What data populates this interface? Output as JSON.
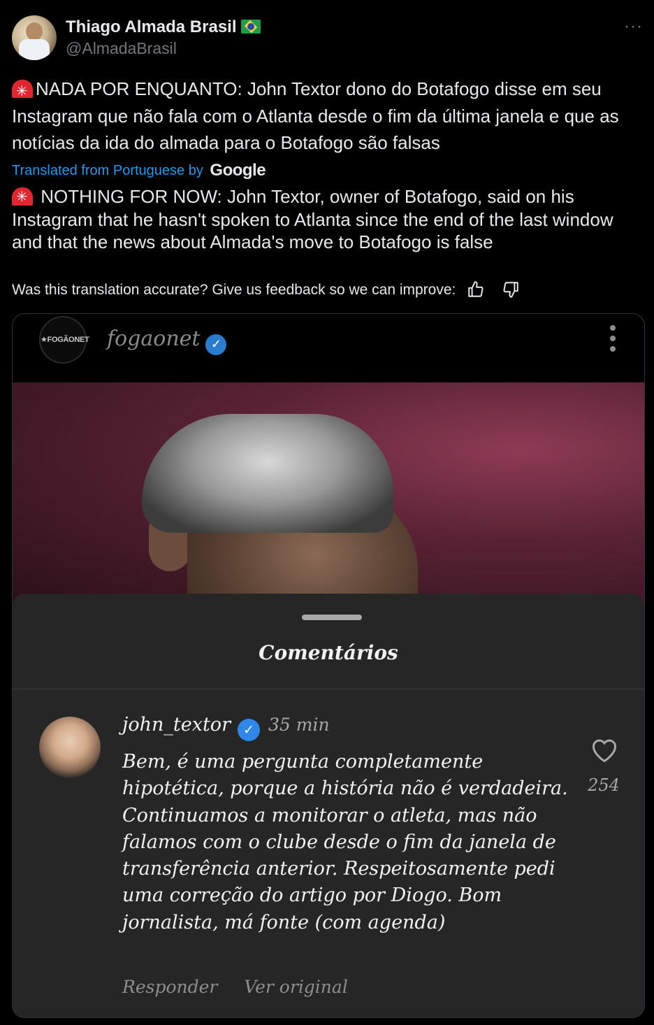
{
  "author": {
    "display_name": "Thiago Almada Brasil",
    "flag_icon": "brazil-flag-icon",
    "handle": "@AlmadaBrasil",
    "more_label": "···"
  },
  "tweet": {
    "original_text": "NADA POR ENQUANTO: John Textor dono do Botafogo disse em seu Instagram que não fala com o Atlanta desde o fim da última janela e que as notícias da ida do almada para o Botafogo são falsas",
    "translated_label": "Translated from Portuguese by",
    "translator_brand": "Google",
    "translated_text": "NOTHING FOR NOW: John Textor, owner of Botafogo, said on his Instagram that he hasn't spoken to Atlanta since the end of the last window and that the news about Almada's move to Botafogo is false",
    "feedback_prompt": "Was this translation accurate? Give us feedback so we can improve:"
  },
  "embed": {
    "account_avatar_text": "★FOGÃONET",
    "account_name": "fogaonet",
    "sheet_title": "Comentários",
    "comment": {
      "username": "john_textor",
      "time": "35 min",
      "text": "Bem, é uma pergunta completamente hipotética, porque a história não é verdadeira. Continuamos a monitorar o atleta, mas não falamos com o clube desde o fim da janela de transferência anterior. Respeitosamente pedi uma correção do artigo por Diogo. Bom jornalista, má fonte (com agenda)",
      "likes": "254",
      "reply_label": "Responder",
      "original_label": "Ver original"
    }
  },
  "colors": {
    "background": "#000000",
    "link": "#1d9bf0",
    "muted": "#71767b",
    "siren": "#e2262f",
    "verified": "#2f88e8"
  }
}
